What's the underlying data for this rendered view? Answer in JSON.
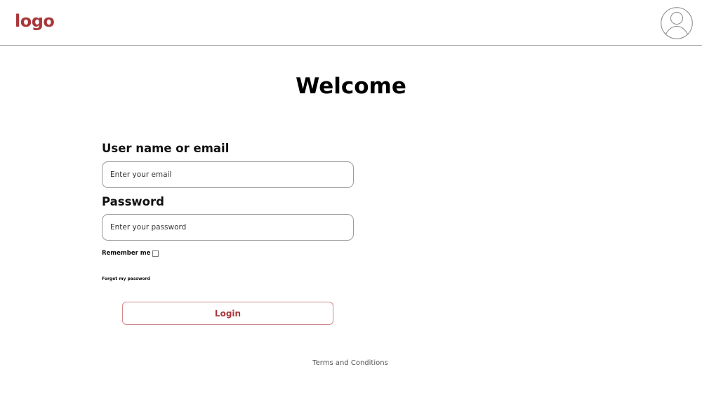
{
  "header": {
    "logo_text": "logo",
    "avatar_icon": "user-avatar-icon"
  },
  "main": {
    "title": "Welcome",
    "username": {
      "label": "User name or email",
      "placeholder": "Enter your email",
      "value": ""
    },
    "password": {
      "label": "Password",
      "placeholder": "Enter your password",
      "value": ""
    },
    "remember_label": "Remember me",
    "remember_checked": false,
    "forgot_label": "Forget my password",
    "login_label": "Login"
  },
  "footer": {
    "terms_label": "Terms and Conditions"
  },
  "colors": {
    "brand": "#a9373a",
    "button_border": "#d28a8c",
    "divider": "#9a9a9a"
  }
}
